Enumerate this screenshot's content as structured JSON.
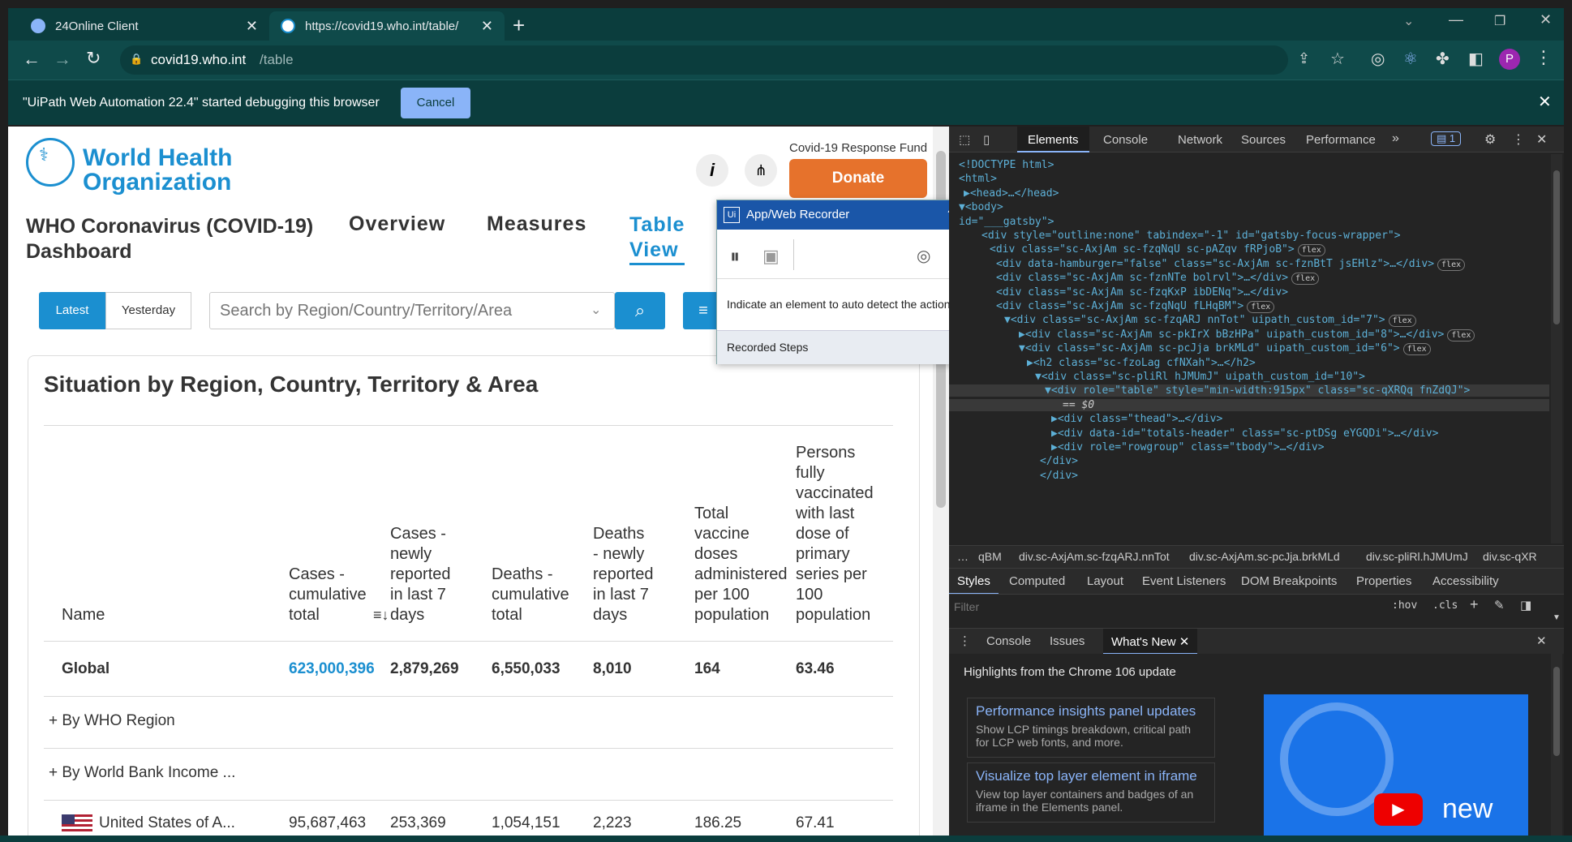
{
  "browser": {
    "tabs": [
      {
        "title": "24Online Client"
      },
      {
        "title": "https://covid19.who.int/table/"
      }
    ],
    "new_tab": "+",
    "url_host": "covid19.who.int",
    "url_path": "/table",
    "profile_initial": "P",
    "infobar_text": "\"UiPath Web Automation 22.4\" started debugging this browser",
    "infobar_cancel": "Cancel"
  },
  "who": {
    "logo_line1": "World Health",
    "logo_line2": "Organization",
    "dashboard_title_1": "WHO Coronavirus (COVID-19)",
    "dashboard_title_2": "Dashboard",
    "nav": [
      "Overview",
      "Measures",
      "Table",
      "View"
    ],
    "fund_label": "Covid-19 Response Fund",
    "donate": "Donate",
    "toggle_latest": "Latest",
    "toggle_yesterday": "Yesterday",
    "search_placeholder": "Search by Region/Country/Territory/Area",
    "section_title": "Situation by Region, Country, Territory & Area",
    "columns": [
      [
        "Name"
      ],
      [
        "Cases -",
        "cumulative",
        "total"
      ],
      [
        "Cases -",
        "newly",
        "reported",
        "in last 7",
        "days"
      ],
      [
        "Deaths -",
        "cumulative",
        "total"
      ],
      [
        "Deaths",
        "- newly",
        "reported",
        "in last 7",
        "days"
      ],
      [
        "Total",
        "vaccine",
        "doses",
        "administered",
        "per 100",
        "population"
      ],
      [
        "Persons",
        "fully",
        "vaccinated",
        "with last",
        "dose of",
        "primary",
        "series per",
        "100",
        "population"
      ]
    ],
    "global_row": [
      "Global",
      "623,000,396",
      "2,879,269",
      "6,550,033",
      "8,010",
      "164",
      "63.46"
    ],
    "group_rows": [
      "+ By WHO Region",
      "+ By World Bank Income ..."
    ],
    "usa_row": [
      "United States of A...",
      "95,687,463",
      "253,369",
      "1,054,151",
      "2,223",
      "186.25",
      "67.41"
    ]
  },
  "recorder": {
    "title": "App/Web Recorder",
    "help": "?",
    "hint": "Indicate an element to auto detect the action",
    "steps": "Recorded Steps"
  },
  "devtools": {
    "tabs": [
      "Elements",
      "Console",
      "Network",
      "Sources",
      "Performance"
    ],
    "issues_count": "1",
    "breadcrumbs": [
      "qBM",
      "div.sc-AxjAm.sc-fzqARJ.nnTot",
      "div.sc-AxjAm.sc-pcJja.brkMLd",
      "div.sc-pliRl.hJMUmJ",
      "div.sc-qXR"
    ],
    "styles_tabs": [
      "Styles",
      "Computed",
      "Layout",
      "Event Listeners",
      "DOM Breakpoints",
      "Properties",
      "Accessibility"
    ],
    "filter_placeholder": "Filter",
    "hov": ":hov",
    "cls": ".cls",
    "drawer_tabs": [
      "Console",
      "Issues",
      "What's New"
    ],
    "whatsnew_title": "Highlights from the Chrome 106 update",
    "cards": [
      {
        "title": "Performance insights panel updates",
        "desc": "Show LCP timings breakdown, critical path for LCP web fonts, and more."
      },
      {
        "title": "Visualize top layer element in iframe",
        "desc": "View top layer containers and badges of an iframe in the Elements panel."
      }
    ],
    "video_label": "new",
    "dom_lines": [
      {
        "t": "<!DOCTYPE html>"
      },
      {
        "t": "<html>"
      },
      {
        "t": "▶<head>…</head>"
      },
      {
        "t": "▼<body>"
      },
      {
        "t": "id=\"___gatsby\">"
      },
      {
        "t": "<div style=\"outline:none\" tabindex=\"-1\" id=\"gatsby-focus-wrapper\">"
      },
      {
        "t": "<div class=\"sc-AxjAm sc-fzqNqU sc-pAZqv fRPjoB\">",
        "pill": "flex"
      },
      {
        "t": "<div data-hamburger=\"false\" class=\"sc-AxjAm sc-fznBtT jsEHlz\">…</div>",
        "pill": "flex"
      },
      {
        "t": "<div class=\"sc-AxjAm sc-fznNTe bolrvl\">…</div>",
        "pill": "flex"
      },
      {
        "t": "<div class=\"sc-AxjAm sc-fzqKxP ibDENq\">…</div>"
      },
      {
        "t": "<div class=\"sc-AxjAm sc-fzqNqU fLHqBM\">",
        "pill": "flex"
      },
      {
        "t": "▼<div class=\"sc-AxjAm sc-fzqARJ nnTot\" uipath_custom_id=\"7\">",
        "pill": "flex"
      },
      {
        "t": "▶<div class=\"sc-AxjAm sc-pkIrX bBzHPa\" uipath_custom_id=\"8\">…</div>",
        "pill": "flex"
      },
      {
        "t": "▼<div class=\"sc-AxjAm sc-pcJja brkMLd\" uipath_custom_id=\"6\">",
        "pill": "flex"
      },
      {
        "t": "▶<h2 class=\"sc-fzoLag cfNXah\">…</h2>"
      },
      {
        "t": "▼<div class=\"sc-pliRl hJMUmJ\" uipath_custom_id=\"10\">"
      },
      {
        "t": "▼<div role=\"table\" style=\"min-width:915px\" class=\"sc-qXRQq fnZdQJ\">"
      },
      {
        "t": "== $0"
      },
      {
        "t": "▶<div class=\"thead\">…</div>"
      },
      {
        "t": "▶<div data-id=\"totals-header\" class=\"sc-ptDSg eYGQDi\">…</div>"
      },
      {
        "t": "▶<div role=\"rowgroup\" class=\"tbody\">…</div>"
      },
      {
        "t": "</div>"
      },
      {
        "t": "</div>"
      }
    ]
  }
}
